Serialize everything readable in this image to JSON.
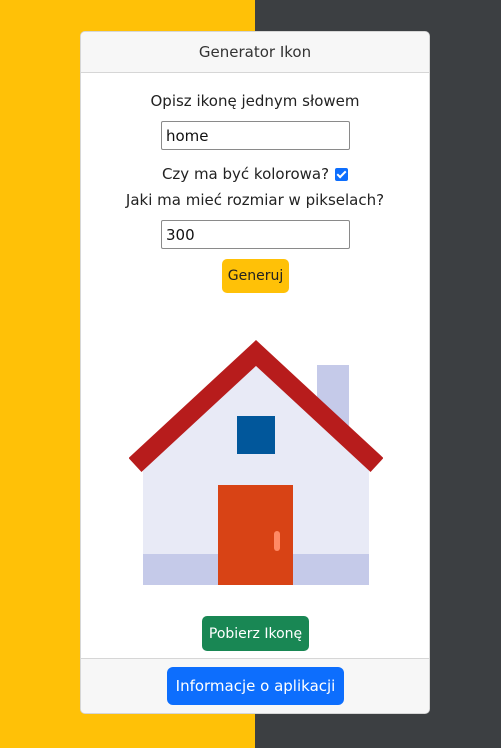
{
  "header": {
    "title": "Generator Ikon"
  },
  "form": {
    "word_label": "Opisz ikonę jednym słowem",
    "word_value": "home",
    "color_label": "Czy ma być kolorowa?",
    "color_checked": true,
    "size_label": "Jaki ma mieć rozmiar w pikselach?",
    "size_value": "300",
    "generate_label": "Generuj"
  },
  "preview": {
    "icon_name": "house-icon"
  },
  "download_label": "Pobierz Ikonę",
  "footer": {
    "info_label": "Informacje o aplikacji"
  },
  "colors": {
    "left_bg": "#ffc107",
    "right_bg": "#3c3f42",
    "generate": "#ffc107",
    "download": "#198754",
    "info": "#0d6efd",
    "roof": "#b71c1c",
    "wall": "#e8eaf6",
    "door": "#d84315",
    "window": "#01579b"
  }
}
